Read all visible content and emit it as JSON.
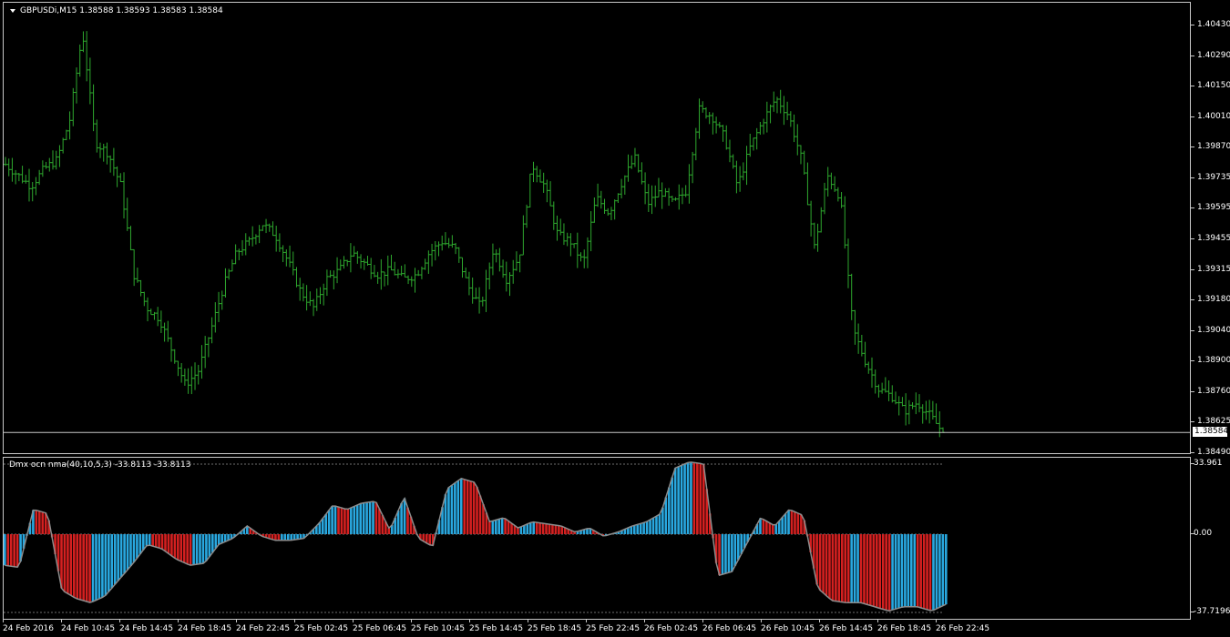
{
  "main_pane": {
    "label": "GBPUSDi,M15  1.38588 1.38593 1.38583 1.38584",
    "current_price": "1.38584",
    "price_ticks": [
      "1.40430",
      "1.40290",
      "1.40150",
      "1.40010",
      "1.39870",
      "1.39735",
      "1.39595",
      "1.39455",
      "1.39315",
      "1.39180",
      "1.39040",
      "1.38900",
      "1.38760",
      "1.38625",
      "1.38490"
    ],
    "bar_color": "#2ea82e"
  },
  "indicator_pane": {
    "label": "Dmx ocn nma(40,10,5,3) -33.8113 -33.8113",
    "scale_labels": [
      "33.961",
      "0.00",
      "-37.7196"
    ],
    "pos_color": "#d42020",
    "neg_color": "#29a8e0",
    "line_color": "#8c8c8c"
  },
  "time_axis": {
    "labels": [
      "24 Feb 2016",
      "24 Feb 10:45",
      "24 Feb 14:45",
      "24 Feb 18:45",
      "24 Feb 22:45",
      "25 Feb 02:45",
      "25 Feb 06:45",
      "25 Feb 10:45",
      "25 Feb 14:45",
      "25 Feb 18:45",
      "25 Feb 22:45",
      "26 Feb 02:45",
      "26 Feb 06:45",
      "26 Feb 10:45",
      "26 Feb 14:45",
      "26 Feb 18:45",
      "26 Feb 22:45"
    ]
  },
  "chart_data": [
    {
      "type": "ohlc",
      "series": [
        {
          "name": "GBPUSDi,M15",
          "values": [
            1.398,
            1.3975,
            1.397,
            1.3978,
            1.3982,
            1.4,
            1.404,
            1.399,
            1.3985,
            1.397,
            1.393,
            1.3915,
            1.391,
            1.3895,
            1.388,
            1.3886,
            1.3905,
            1.3925,
            1.394,
            1.3945,
            1.3953,
            1.3948,
            1.3936,
            1.3922,
            1.3915,
            1.3928,
            1.3932,
            1.394,
            1.3935,
            1.393,
            1.3932,
            1.3928,
            1.393,
            1.394,
            1.3945,
            1.3942,
            1.3925,
            1.3915,
            1.3942,
            1.3928,
            1.3938,
            1.398,
            1.397,
            1.3948,
            1.3945,
            1.3935,
            1.3965,
            1.3958,
            1.3972,
            1.3983,
            1.3962,
            1.3968,
            1.3962,
            1.3968,
            1.4005,
            1.4002,
            1.3992,
            1.397,
            1.3988,
            1.4,
            1.401,
            1.4002,
            1.3982,
            1.3942,
            1.3975,
            1.3965,
            1.3905,
            1.389,
            1.3878,
            1.3875,
            1.3868,
            1.3872,
            1.3866,
            1.38584
          ]
        }
      ],
      "ylim": [
        1.3849,
        1.4043
      ]
    },
    {
      "type": "bar",
      "series": [
        {
          "name": "Dmx ocn nma(40,10,5,3)",
          "values": [
            -15,
            -16,
            12,
            10,
            -27,
            -31,
            -33,
            -30,
            -22,
            -14,
            -5,
            -7,
            -12,
            -15,
            -14,
            -5,
            -2,
            4,
            -1,
            -3,
            -3,
            -2,
            5,
            14,
            12,
            15,
            16,
            2,
            18,
            -2,
            -6,
            22,
            27,
            25,
            6,
            8,
            3,
            6,
            5,
            4,
            1,
            3,
            -1,
            1,
            4,
            6,
            10,
            32,
            35,
            34,
            -20,
            -18,
            -5,
            8,
            4,
            12,
            9,
            -26,
            -32,
            -33,
            -33,
            -35,
            -37,
            -35,
            -35,
            -37,
            -33.8113
          ]
        }
      ],
      "ylim": [
        -37.7196,
        33.961
      ]
    }
  ]
}
